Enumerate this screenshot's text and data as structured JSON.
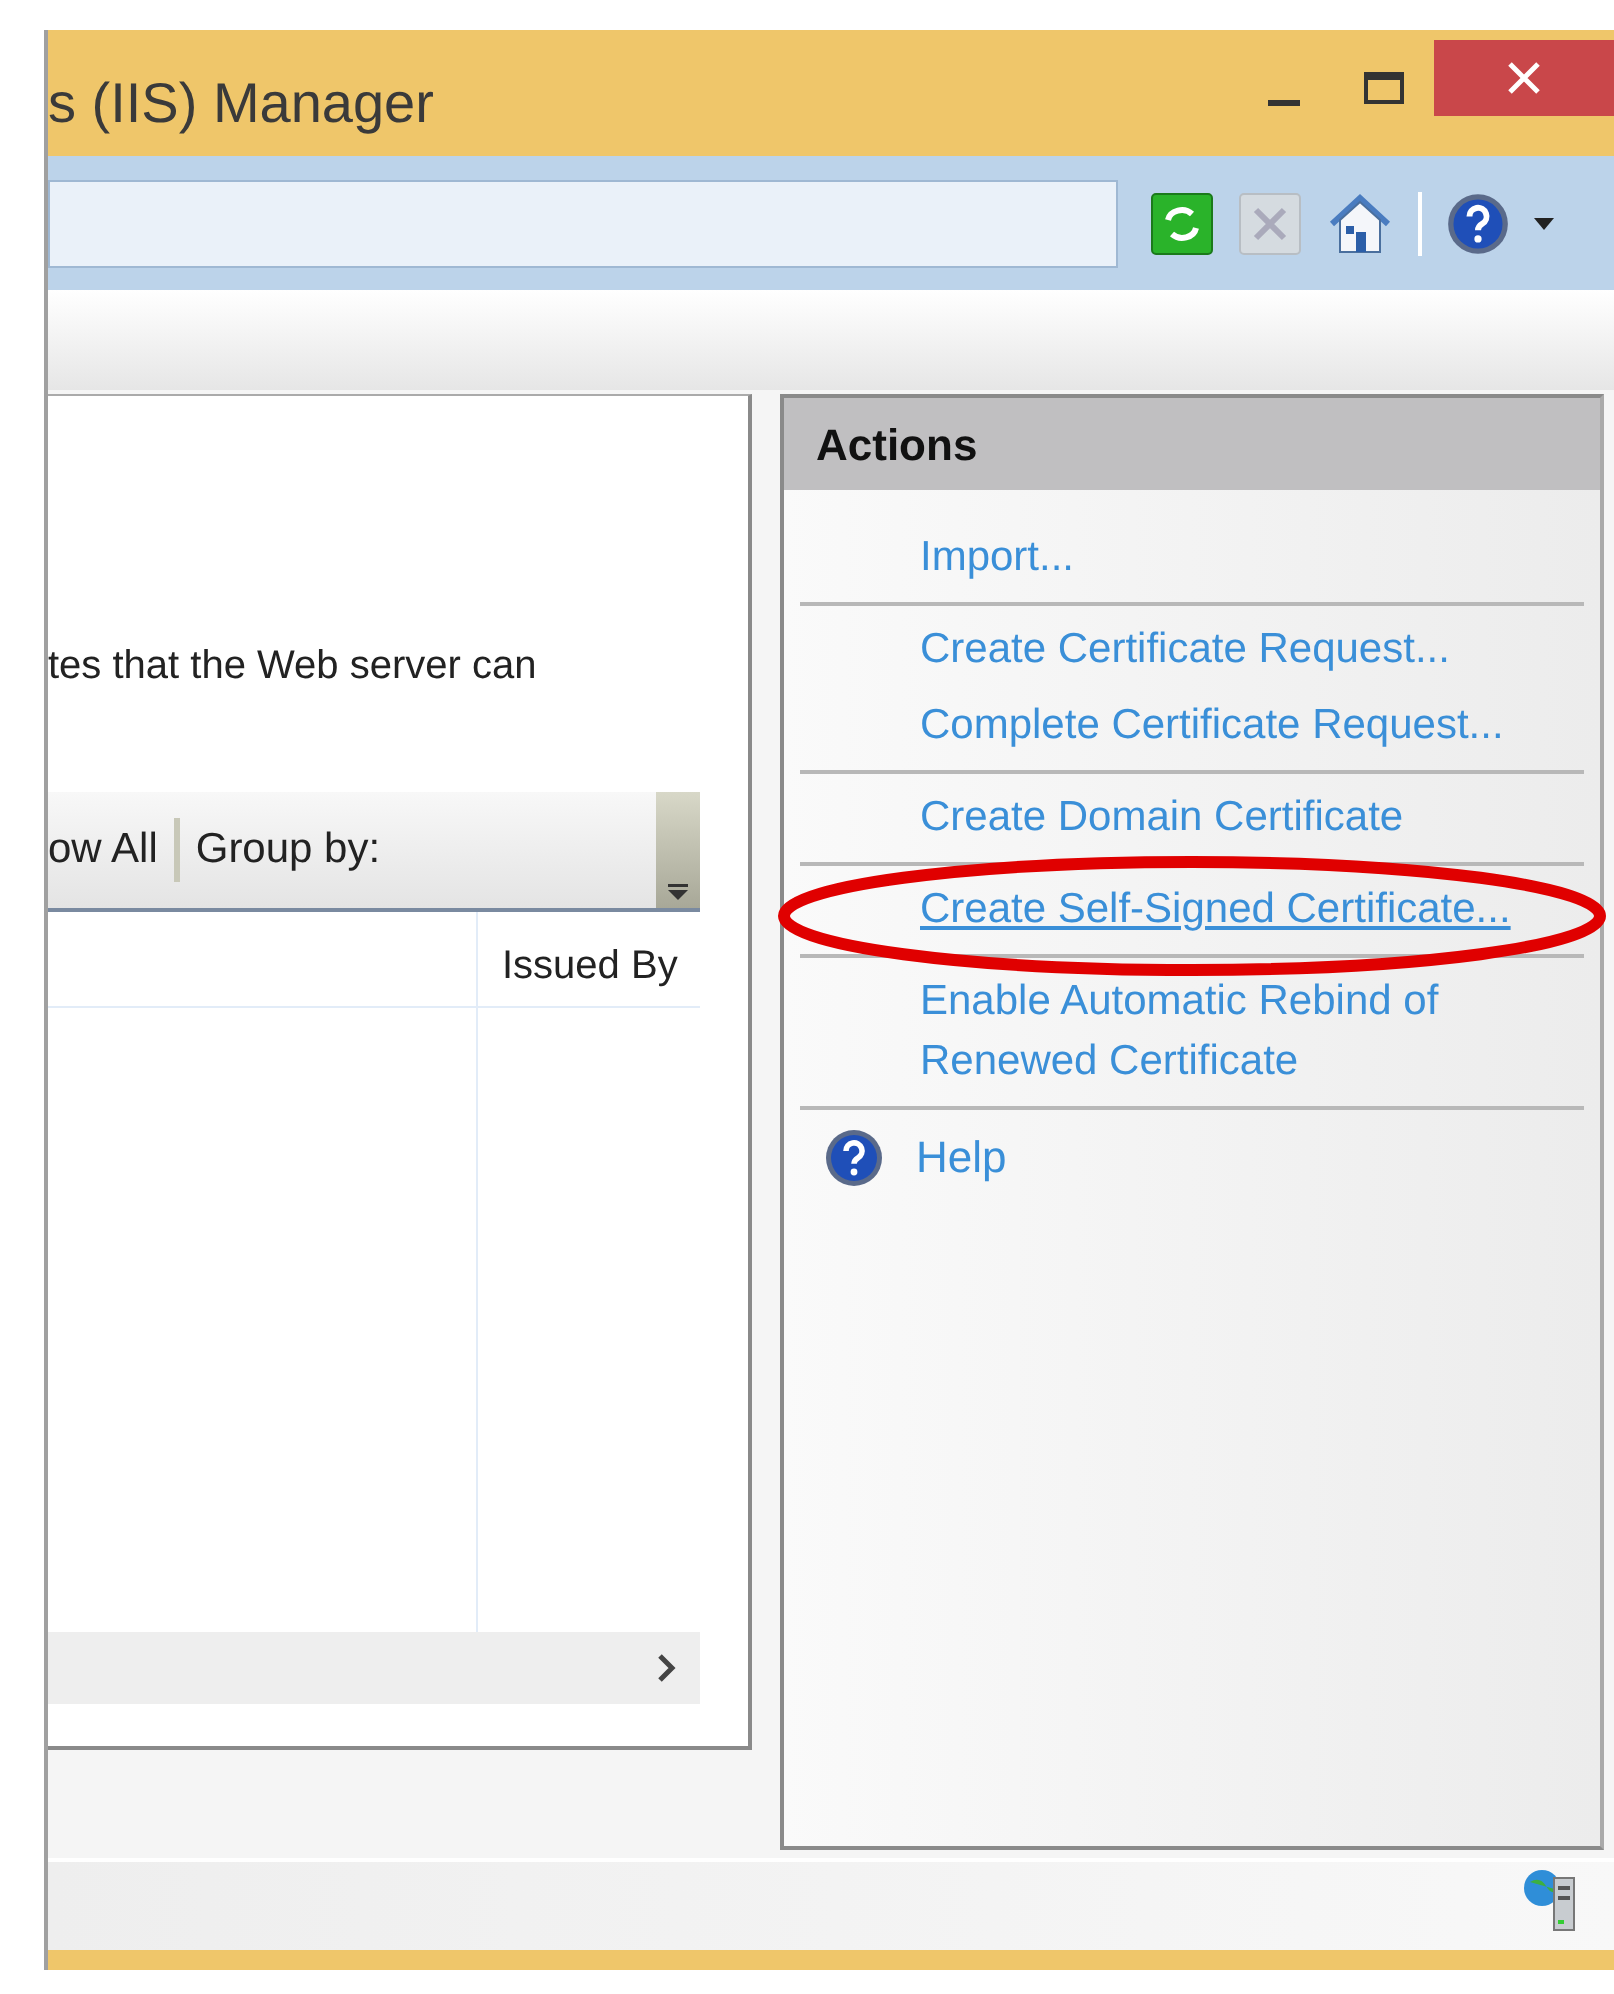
{
  "window": {
    "title": "s (IIS) Manager"
  },
  "features": {
    "description": "tes that the Web server can",
    "grid_toolbar": [
      {
        "label": "ow All"
      },
      {
        "label": "Group by:"
      }
    ],
    "columns": [
      "Issued By"
    ]
  },
  "actions": {
    "title": "Actions",
    "groups": [
      [
        {
          "label": "Import...",
          "kind": "link",
          "hover": false
        }
      ],
      [
        {
          "label": "Create Certificate Request...",
          "kind": "link",
          "hover": false
        },
        {
          "label": "Complete Certificate Request...",
          "kind": "link",
          "hover": false
        }
      ],
      [
        {
          "label": "Create Domain Certificate",
          "kind": "link",
          "hover": false
        }
      ],
      [
        {
          "label": "Create Self-Signed Certificate...",
          "kind": "link",
          "hover": true
        }
      ],
      [
        {
          "label": "Enable Automatic Rebind of Renewed Certificate",
          "kind": "link",
          "hover": false
        }
      ],
      [
        {
          "label": "Help",
          "kind": "help",
          "hover": false
        }
      ]
    ]
  },
  "annotation": {
    "kind": "ellipse",
    "color": "#e00000"
  }
}
